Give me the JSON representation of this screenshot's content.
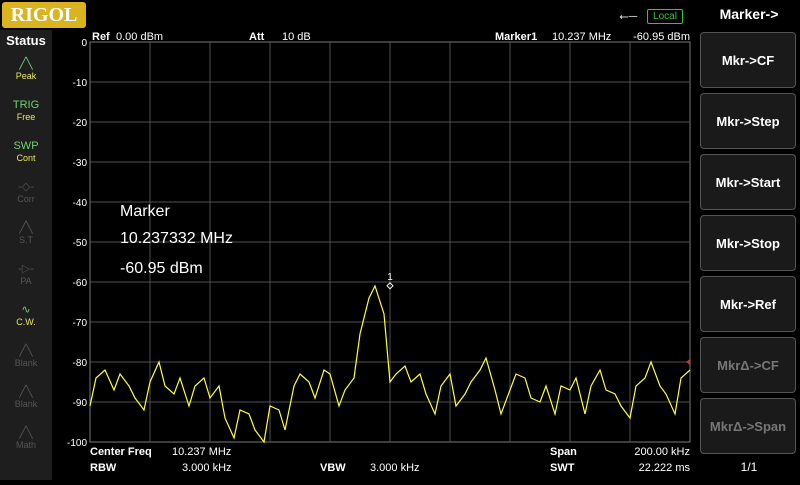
{
  "brand": "RIGOL",
  "top": {
    "usb_icon": "usb-icon",
    "local": "Local"
  },
  "status": {
    "title": "Status",
    "items": [
      {
        "icon": "╱╲",
        "label": "Peak",
        "on": true
      },
      {
        "icon": "TRIG",
        "label": "Free",
        "on": true
      },
      {
        "icon": "SWP",
        "label": "Cont",
        "on": true
      },
      {
        "icon": "-◇-",
        "label": "Corr",
        "on": false
      },
      {
        "icon": "╱╲",
        "label": "S.T",
        "on": false
      },
      {
        "icon": "-▷-",
        "label": "PA",
        "on": false
      },
      {
        "icon": "∿",
        "label": "C.W.",
        "on": true
      },
      {
        "icon": "╱╲",
        "label": "Blank",
        "on": false
      },
      {
        "icon": "╱╲",
        "label": "Blank",
        "on": false
      },
      {
        "icon": "╱╲",
        "label": "Math",
        "on": false
      }
    ]
  },
  "header": {
    "ref_label": "Ref",
    "ref_value": "0.00 dBm",
    "att_label": "Att",
    "att_value": "10 dB",
    "marker_label": "Marker1",
    "marker_freq": "10.237 MHz",
    "marker_amp": "-60.95 dBm"
  },
  "marker_box": {
    "title": "Marker",
    "freq": "10.237332 MHz",
    "amp": "-60.95 dBm",
    "number": "1"
  },
  "footer": {
    "center_label": "Center Freq",
    "center_value": "10.237 MHz",
    "span_label": "Span",
    "span_value": "200.00 kHz",
    "rbw_label": "RBW",
    "rbw_value": "3.000 kHz",
    "vbw_label": "VBW",
    "vbw_value": "3.000 kHz",
    "swt_label": "SWT",
    "swt_value": "22.222 ms"
  },
  "menu": {
    "title": "Marker->",
    "buttons": [
      {
        "label": "Mkr->CF",
        "enabled": true
      },
      {
        "label": "Mkr->Step",
        "enabled": true
      },
      {
        "label": "Mkr->Start",
        "enabled": true
      },
      {
        "label": "Mkr->Stop",
        "enabled": true
      },
      {
        "label": "Mkr->Ref",
        "enabled": true
      },
      {
        "label": "MkrΔ->CF",
        "enabled": false
      },
      {
        "label": "MkrΔ->Span",
        "enabled": false
      }
    ],
    "page": "1/1"
  },
  "colors": {
    "trace": "#ffff33",
    "grid": "#505050",
    "status_on": "#6fd36f",
    "local": "#3cc23c",
    "logo": "#d9b320"
  },
  "chart_data": {
    "type": "line",
    "xlabel": "",
    "ylabel": "",
    "ylim": [
      -100,
      0
    ],
    "yticks": [
      "0",
      "-10",
      "-20",
      "-30",
      "-40",
      "-50",
      "-60",
      "-70",
      "-80",
      "-90",
      "-100"
    ],
    "grid": true,
    "series": [
      {
        "x": [
          -100,
          -98,
          -95,
          -92,
          -90,
          -87,
          -85,
          -82,
          -80,
          -77,
          -75,
          -72,
          -70,
          -67,
          -65,
          -62,
          -60,
          -57,
          -55,
          -52,
          -50,
          -47,
          -45,
          -42,
          -40,
          -37,
          -35,
          -32,
          -30,
          -27,
          -25,
          -22,
          -20,
          -17,
          -15,
          -12,
          -10,
          -7,
          -5,
          -2,
          0,
          2,
          5,
          7,
          10,
          12,
          15,
          17,
          20,
          22,
          25,
          27,
          30,
          32,
          35,
          37,
          40,
          42,
          45,
          47,
          50,
          52,
          55,
          57,
          60,
          62,
          65,
          67,
          70,
          72,
          75,
          77,
          80,
          82,
          85,
          87,
          90,
          92,
          95,
          97,
          100
        ],
        "y": [
          -91,
          -84,
          -82,
          -87,
          -83,
          -86,
          -89,
          -92,
          -85,
          -80,
          -86,
          -88,
          -84,
          -91,
          -86,
          -84,
          -89,
          -86,
          -94,
          -99,
          -92,
          -93,
          -97,
          -100,
          -91,
          -92,
          -97,
          -86,
          -83,
          -85,
          -89,
          -82,
          -83,
          -91,
          -87,
          -84,
          -73,
          -64,
          -61,
          -68,
          -85,
          -83,
          -81,
          -85,
          -83,
          -88,
          -93,
          -86,
          -83,
          -91,
          -88,
          -85,
          -82,
          -79,
          -87,
          -93,
          -87,
          -83,
          -84,
          -89,
          -90,
          -86,
          -93,
          -86,
          -87,
          -84,
          -93,
          -86,
          -82,
          -87,
          -88,
          -91,
          -94,
          -86,
          -84,
          -80,
          -86,
          -88,
          -93,
          -84,
          -82
        ]
      }
    ],
    "marker": {
      "x": 0,
      "y": -60.95,
      "label": "1"
    }
  }
}
